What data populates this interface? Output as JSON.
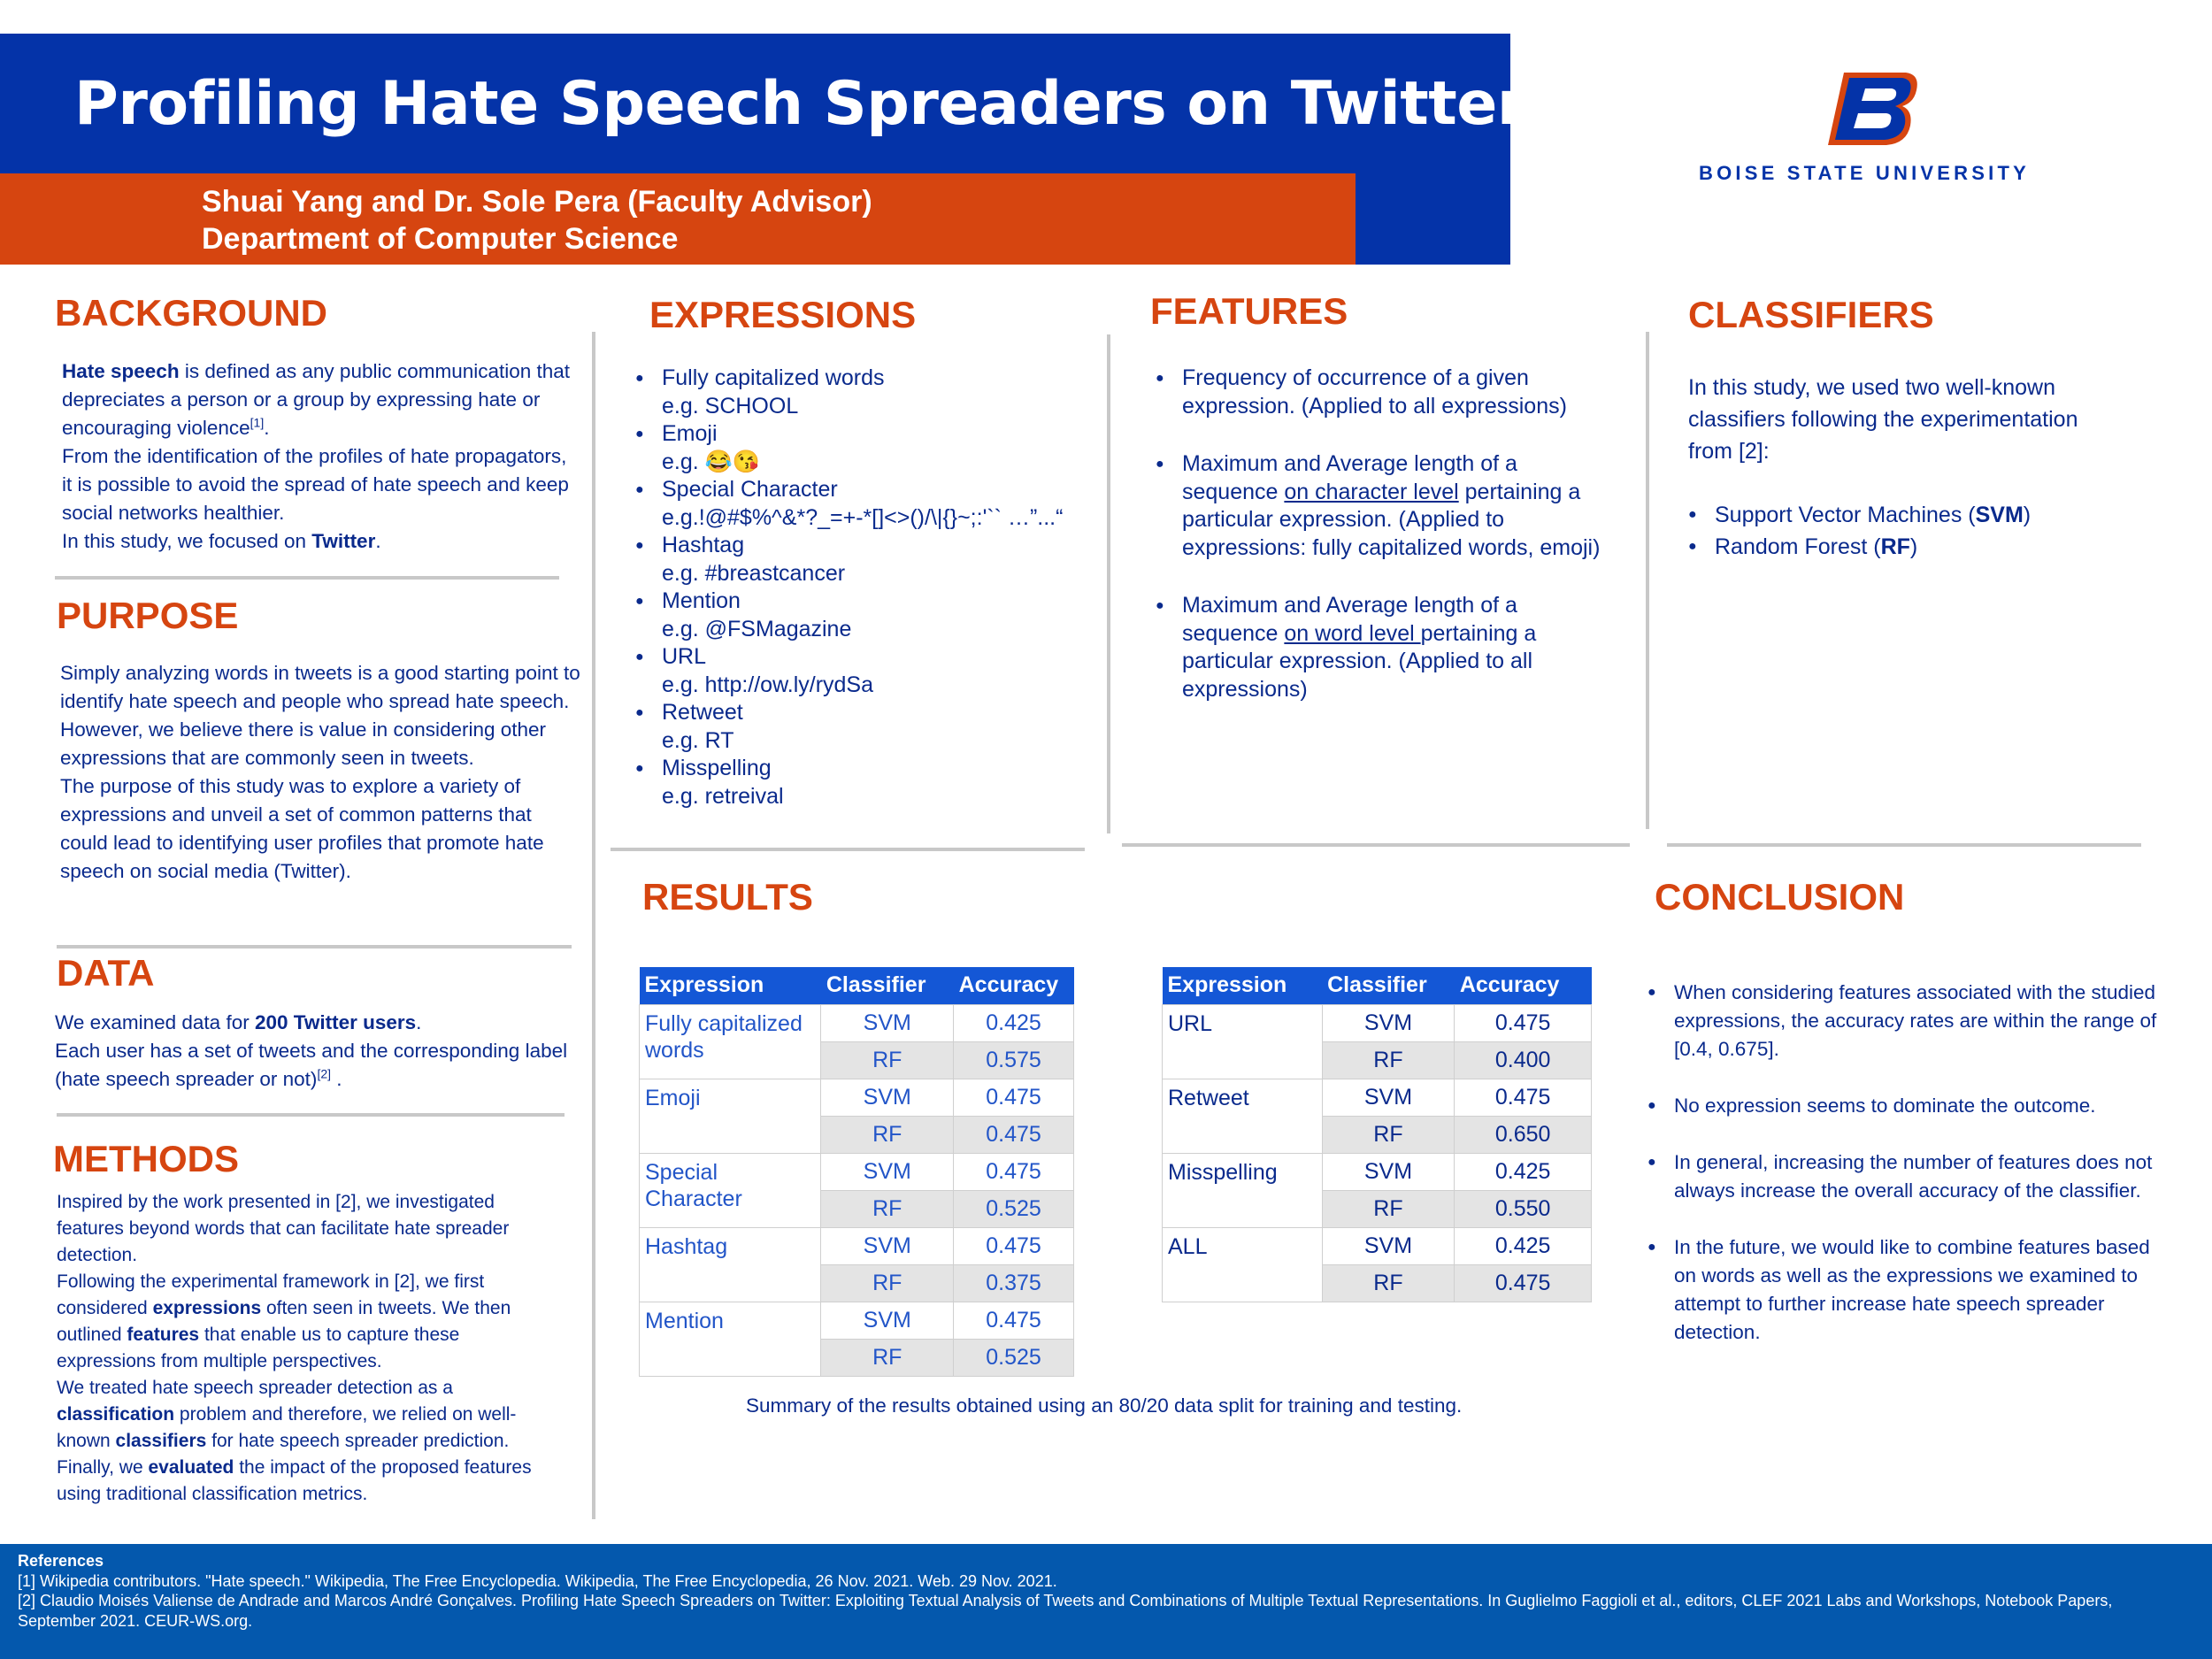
{
  "header": {
    "title": "Profiling Hate Speech Spreaders on Twitter",
    "authors": "Shuai Yang and Dr. Sole Pera (Faculty Advisor)",
    "department": "Department of Computer Science",
    "university": "BOISE STATE UNIVERSITY",
    "colors": {
      "blue": "#0433a8",
      "orange": "#d64510"
    }
  },
  "background": {
    "heading": "BACKGROUND",
    "p1_bold": "Hate speech",
    "p1_rest": " is defined as any public communication that depreciates a person or a group by expressing hate or encouraging violence",
    "p1_ref": "[1]",
    "p2": "From the identification of the profiles of hate propagators, it is possible to avoid the spread of hate speech and keep social networks healthier.",
    "p3_pre": "In this study, we focused on ",
    "p3_bold": "Twitter"
  },
  "purpose": {
    "heading": "PURPOSE",
    "p1": "Simply analyzing words in tweets is a good starting point to identify hate speech and people who spread hate speech. However, we believe there is value in considering other expressions that are commonly seen in tweets.",
    "p2": "The purpose of this study was to explore a variety of expressions and unveil a set of common patterns that could lead to identifying user profiles that promote hate speech on social media (Twitter)."
  },
  "data": {
    "heading": "DATA",
    "p1_pre": "We examined data for ",
    "p1_bold": "200 Twitter users",
    "p2": "Each user has a set of tweets and the corresponding label (hate speech spreader or not)",
    "p2_ref": "[2]"
  },
  "methods": {
    "heading": "METHODS",
    "p1": "Inspired by the work presented in [2], we investigated features beyond words that can facilitate hate spreader detection.",
    "p2_a": "Following the experimental framework in [2], we first considered ",
    "p2_b": "expressions",
    "p2_c": " often seen in tweets. We then outlined ",
    "p2_d": "features",
    "p2_e": " that enable us to capture these expressions from multiple perspectives.",
    "p3_a": "We treated hate speech spreader detection as a ",
    "p3_b": "classification",
    "p3_c": " problem and therefore, we relied on well-known ",
    "p3_d": "classifiers",
    "p3_e": " for hate speech spreader prediction.",
    "p4_a": "Finally, we ",
    "p4_b": "evaluated",
    "p4_c": " the impact of the proposed features using traditional classification metrics."
  },
  "expressions": {
    "heading": "EXPRESSIONS",
    "items": [
      {
        "name": "Fully capitalized words",
        "example": "e.g. SCHOOL"
      },
      {
        "name": "Emoji",
        "example": "e.g. 😂😘"
      },
      {
        "name": "Special Character",
        "example": "e.g.!@#$%^&*?_=+-*[]<>()/\\|{}~;:'`` …”...“"
      },
      {
        "name": "Hashtag",
        "example": "e.g. #breastcancer"
      },
      {
        "name": "Mention",
        "example": "e.g. @FSMagazine"
      },
      {
        "name": "URL",
        "example": "e.g. http://ow.ly/rydSa"
      },
      {
        "name": "Retweet",
        "example": "e.g. RT"
      },
      {
        "name": "Misspelling",
        "example": "e.g. retreival"
      }
    ]
  },
  "features": {
    "heading": "FEATURES",
    "f1": "Frequency of occurrence of a given expression. (Applied to all expressions)",
    "f2_a": "Maximum and Average length of a sequence ",
    "f2_u": "on character level",
    "f2_b": " pertaining a particular expression. (Applied to expressions: fully capitalized words, emoji)",
    "f3_a": "Maximum and Average length of a sequence ",
    "f3_u": "on word level ",
    "f3_b": "pertaining a particular expression. (Applied to all expressions)"
  },
  "classifiers": {
    "heading": "CLASSIFIERS",
    "intro": "In this study, we used two well-known classifiers following the experimentation from [2]:",
    "svm_pre": "Support Vector Machines (",
    "svm_bold": "SVM",
    "svm_post": ")",
    "rf_pre": "Random Forest (",
    "rf_bold": "RF",
    "rf_post": ")"
  },
  "results": {
    "heading": "RESULTS",
    "columns": [
      "Expression",
      "Classifier",
      "Accuracy"
    ],
    "table1": [
      {
        "expression": "Fully capitalized words",
        "rows": [
          [
            "SVM",
            "0.425"
          ],
          [
            "RF",
            "0.575"
          ]
        ]
      },
      {
        "expression": "Emoji",
        "rows": [
          [
            "SVM",
            "0.475"
          ],
          [
            "RF",
            "0.475"
          ]
        ]
      },
      {
        "expression": "Special Character",
        "rows": [
          [
            "SVM",
            "0.475"
          ],
          [
            "RF",
            "0.525"
          ]
        ]
      },
      {
        "expression": "Hashtag",
        "rows": [
          [
            "SVM",
            "0.475"
          ],
          [
            "RF",
            "0.375"
          ]
        ]
      },
      {
        "expression": "Mention",
        "rows": [
          [
            "SVM",
            "0.475"
          ],
          [
            "RF",
            "0.525"
          ]
        ]
      }
    ],
    "table2": [
      {
        "expression": "URL",
        "rows": [
          [
            "SVM",
            "0.475"
          ],
          [
            "RF",
            "0.400"
          ]
        ]
      },
      {
        "expression": "Retweet",
        "rows": [
          [
            "SVM",
            "0.475"
          ],
          [
            "RF",
            "0.650"
          ]
        ]
      },
      {
        "expression": "Misspelling",
        "rows": [
          [
            "SVM",
            "0.425"
          ],
          [
            "RF",
            "0.550"
          ]
        ]
      },
      {
        "expression": "ALL",
        "rows": [
          [
            "SVM",
            "0.425"
          ],
          [
            "RF",
            "0.475"
          ]
        ]
      }
    ],
    "caption": "Summary of the results obtained using an 80/20 data split for training and testing."
  },
  "conclusion": {
    "heading": "CONCLUSION",
    "items": [
      "When considering features associated with the studied expressions, the accuracy rates are within the range of [0.4, 0.675].",
      "No expression seems to dominate the outcome.",
      "In general, increasing the number of features does not always increase the overall accuracy of the classifier.",
      "In the future, we would like to combine features based on words as well as the expressions we examined to attempt to further increase hate speech spreader detection."
    ]
  },
  "references": {
    "heading": "References",
    "r1": "[1] Wikipedia contributors. \"Hate speech.\" Wikipedia, The Free Encyclopedia. Wikipedia, The Free Encyclopedia, 26 Nov. 2021. Web. 29 Nov. 2021.",
    "r2": "[2] Claudio Moisés Valiense de Andrade and Marcos André Gonçalves. Profiling Hate Speech Spreaders on Twitter: Exploiting Textual Analysis of Tweets and Combinations of Multiple Textual Representations. In Guglielmo Faggioli et al., editors, CLEF 2021 Labs and Workshops, Notebook Papers, September 2021. CEUR-WS.org."
  }
}
